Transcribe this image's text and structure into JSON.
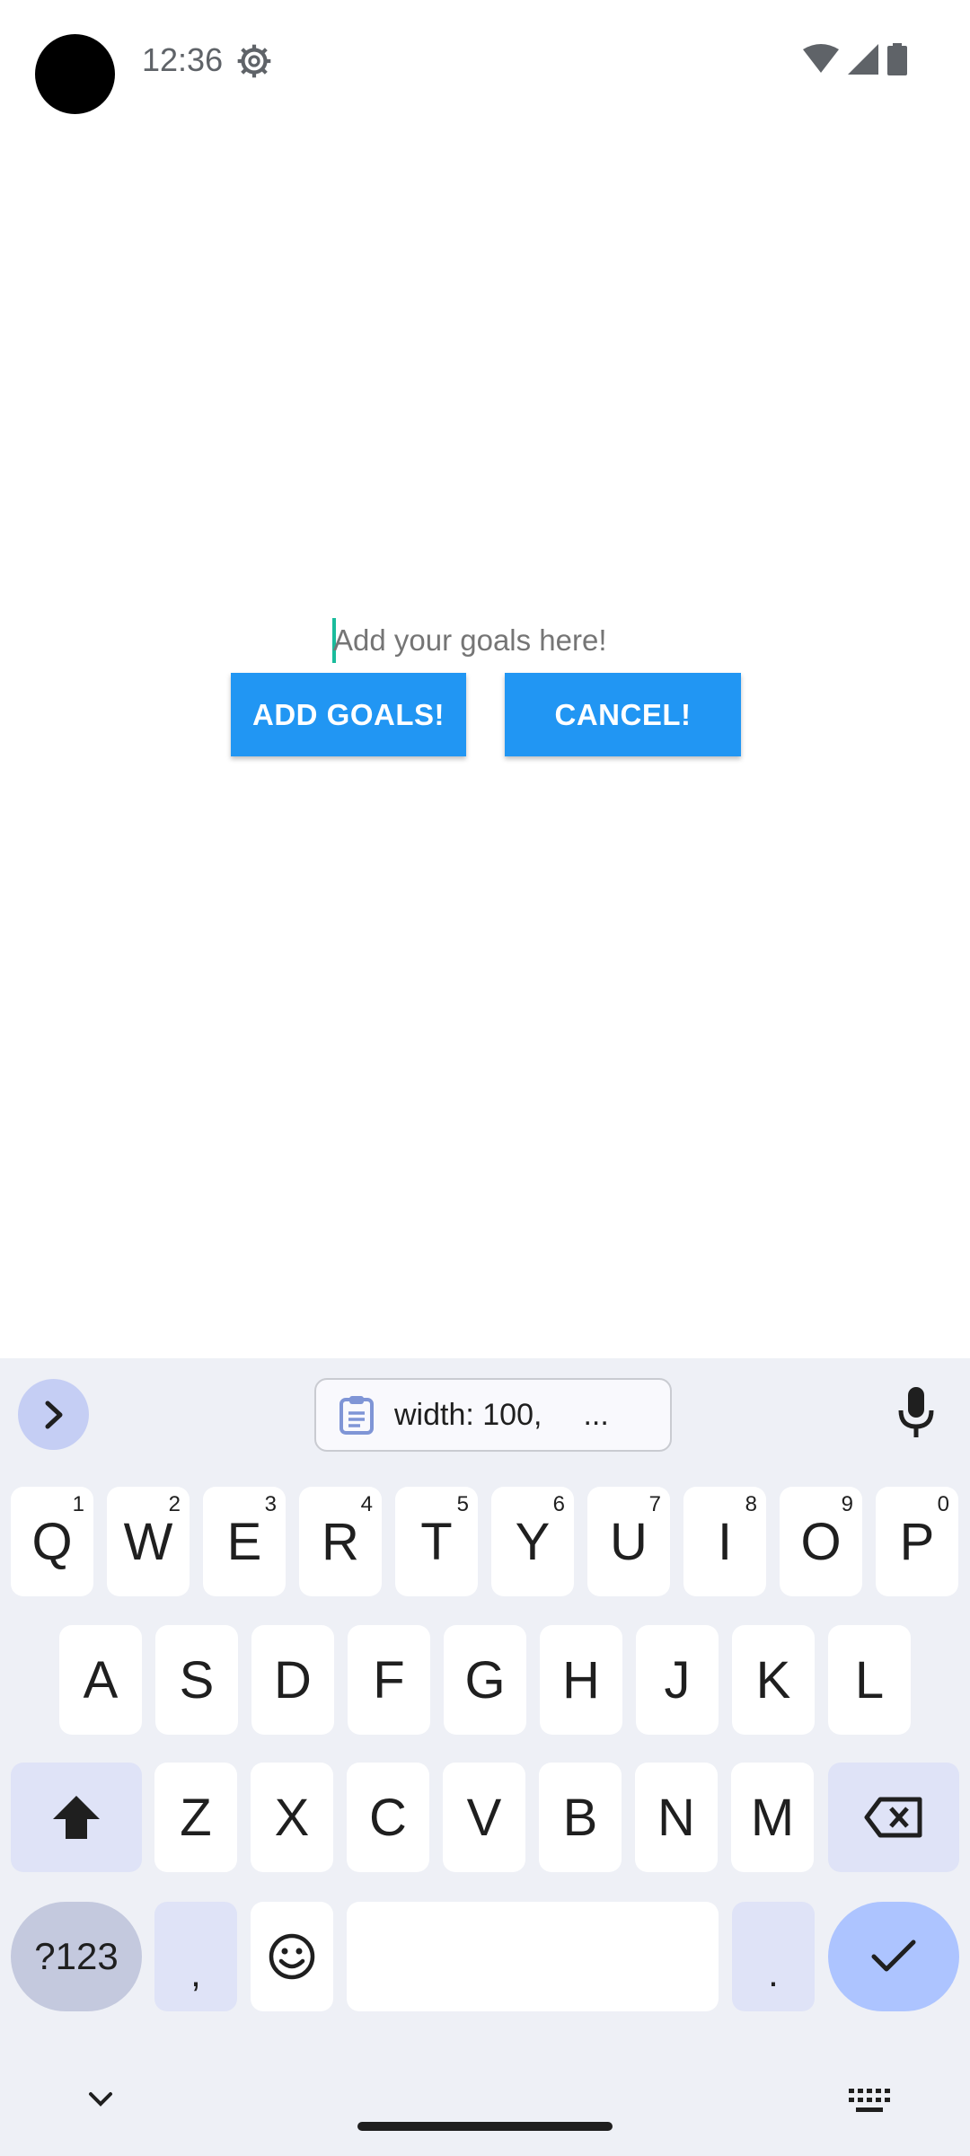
{
  "status_bar": {
    "time": "12:36",
    "icons": [
      "gear-icon",
      "wifi-icon",
      "signal-icon",
      "battery-icon"
    ]
  },
  "goal_input": {
    "placeholder": "Add your goals here!",
    "value": ""
  },
  "buttons": {
    "add_label": "ADD GOALS!",
    "cancel_label": "CANCEL!"
  },
  "colors": {
    "button": "#2196f3",
    "cursor": "#1abc9c",
    "keyboard_bg": "#eef0f6"
  },
  "keyboard": {
    "clipboard_chip_text": "width: 100,",
    "clipboard_chip_ellipsis": "...",
    "row1": [
      {
        "key": "Q",
        "hint": "1"
      },
      {
        "key": "W",
        "hint": "2"
      },
      {
        "key": "E",
        "hint": "3"
      },
      {
        "key": "R",
        "hint": "4"
      },
      {
        "key": "T",
        "hint": "5"
      },
      {
        "key": "Y",
        "hint": "6"
      },
      {
        "key": "U",
        "hint": "7"
      },
      {
        "key": "I",
        "hint": "8"
      },
      {
        "key": "O",
        "hint": "9"
      },
      {
        "key": "P",
        "hint": "0"
      }
    ],
    "row2": [
      "A",
      "S",
      "D",
      "F",
      "G",
      "H",
      "J",
      "K",
      "L"
    ],
    "row3": [
      "Z",
      "X",
      "C",
      "V",
      "B",
      "N",
      "M"
    ],
    "symbols_label": "?123",
    "comma_label": ",",
    "period_label": "."
  }
}
